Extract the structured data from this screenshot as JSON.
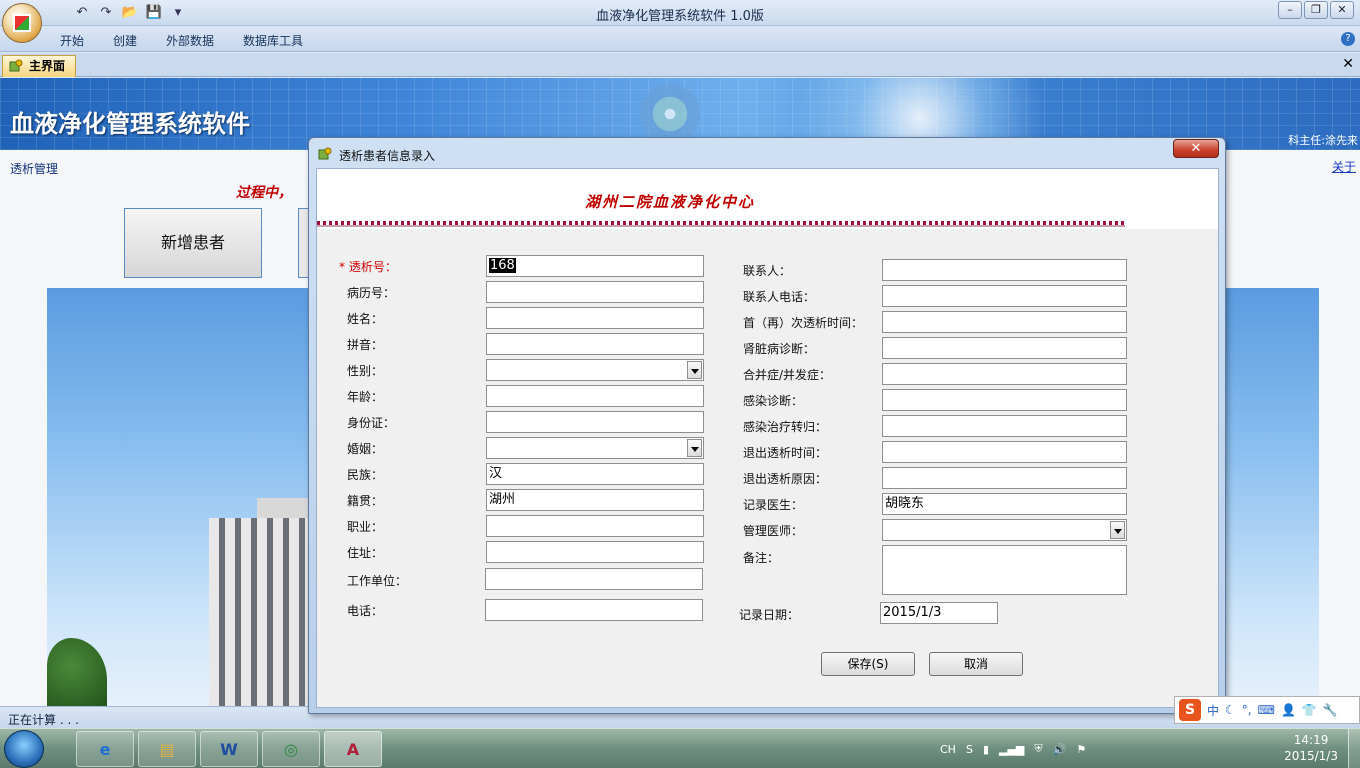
{
  "window": {
    "title": "血液净化管理系统软件 1.0版",
    "controls": [
      "–",
      "❐",
      "✕"
    ]
  },
  "ribbon": {
    "tabs": [
      "开始",
      "创建",
      "外部数据",
      "数据库工具"
    ],
    "help": "?"
  },
  "doc_tab": {
    "label": "主界面",
    "close": "✕"
  },
  "banner": {
    "title": "血液净化管理系统软件",
    "director": "科主任:涂先来"
  },
  "main": {
    "nav_title": "透析管理",
    "about_link": "关于",
    "marquee": "过程中，",
    "new_patient_button": "新增患者"
  },
  "statusbar": {
    "text": "正在计算 . . ."
  },
  "dialog": {
    "title": "透析患者信息录入",
    "close": "✕",
    "heading": "湖州二院血液净化中心",
    "left_fields": [
      {
        "label": "* 透析号：",
        "value": "168",
        "type": "text"
      },
      {
        "label": "病历号：",
        "value": "",
        "type": "text"
      },
      {
        "label": "姓名：",
        "value": "",
        "type": "text"
      },
      {
        "label": "拼音：",
        "value": "",
        "type": "text"
      },
      {
        "label": "性别：",
        "value": "",
        "type": "select"
      },
      {
        "label": "年龄：",
        "value": "",
        "type": "text"
      },
      {
        "label": "身份证：",
        "value": "",
        "type": "text"
      },
      {
        "label": "婚姻：",
        "value": "",
        "type": "select"
      },
      {
        "label": "民族：",
        "value": "汉",
        "type": "text"
      },
      {
        "label": "籍贯：",
        "value": "湖州",
        "type": "text"
      },
      {
        "label": "职业：",
        "value": "",
        "type": "text"
      },
      {
        "label": "住址：",
        "value": "",
        "type": "text"
      },
      {
        "label": "工作单位：",
        "value": "",
        "type": "text"
      },
      {
        "label": "电话：",
        "value": "",
        "type": "text"
      }
    ],
    "right_fields": [
      {
        "label": "联系人：",
        "value": "",
        "type": "text"
      },
      {
        "label": "联系人电话：",
        "value": "",
        "type": "text"
      },
      {
        "label": "首（再）次透析时间：",
        "value": "",
        "type": "text"
      },
      {
        "label": "肾脏病诊断：",
        "value": "",
        "type": "text"
      },
      {
        "label": "合并症/并发症：",
        "value": "",
        "type": "text"
      },
      {
        "label": "感染诊断：",
        "value": "",
        "type": "text"
      },
      {
        "label": "感染治疗转归：",
        "value": "",
        "type": "text"
      },
      {
        "label": "退出透析时间：",
        "value": "",
        "type": "text"
      },
      {
        "label": "退出透析原因：",
        "value": "",
        "type": "text"
      },
      {
        "label": "记录医生：",
        "value": "胡晓东",
        "type": "text"
      },
      {
        "label": "管理医师：",
        "value": "",
        "type": "select"
      },
      {
        "label": "备注：",
        "value": "",
        "type": "textarea"
      }
    ],
    "record_date_label": "记录日期：",
    "record_date_value": "2015/1/3",
    "save_button": "保存(S)",
    "cancel_button": "取消"
  },
  "ime": {
    "logo": "S",
    "mode": "中"
  },
  "taskbar": {
    "lang": "CH",
    "time": "14:19",
    "date": "2015/1/3"
  }
}
